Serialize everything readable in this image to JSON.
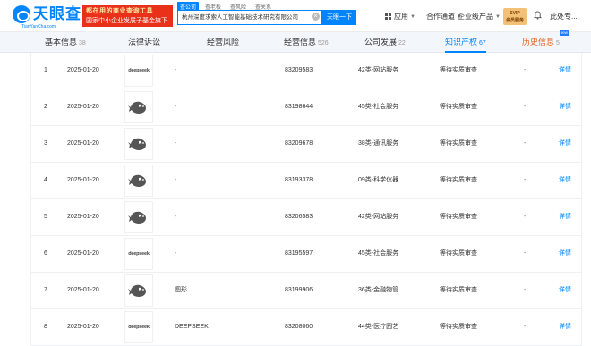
{
  "header": {
    "logo_text": "天眼查",
    "logo_sub": "TianYanCha.com",
    "promo_line1": "都在用的商业查询工具",
    "promo_line2": "国家中小企业发展子基金旗下机构",
    "search_tabs": [
      "查公司",
      "查老板",
      "查风险",
      "查关系"
    ],
    "search_value": "杭州深度求索人工智能基础技术研究有限公司",
    "search_button": "天眼一下",
    "nav": [
      {
        "label": "应用",
        "icon": "grid-icon"
      },
      {
        "label": "合作通道"
      },
      {
        "label": "企业级产品"
      }
    ],
    "vip_line1": "SVIP",
    "vip_line2": "会员服务",
    "user_name": "此处专..."
  },
  "tabs": [
    {
      "label": "基本信息",
      "count": "38"
    },
    {
      "label": "法律诉讼",
      "count": ""
    },
    {
      "label": "经营风险",
      "count": ""
    },
    {
      "label": "经营信息",
      "count": "526"
    },
    {
      "label": "公司发展",
      "count": "22"
    },
    {
      "label": "知识产权",
      "count": "67"
    },
    {
      "label": "历史信息",
      "count": "5",
      "badge": "new"
    }
  ],
  "rows": [
    {
      "idx": "1",
      "date": "2025-01-20",
      "logo": "deepseek-wordmark",
      "logo_text": "deepseek",
      "name": "-",
      "regno": "83209583",
      "class": "42类-网站服务",
      "status": "等待实质审查",
      "dash": "-",
      "detail": "详情"
    },
    {
      "idx": "2",
      "date": "2025-01-20",
      "logo": "whale-icon",
      "logo_text": "",
      "name": "-",
      "regno": "83198644",
      "class": "45类-社会服务",
      "status": "等待实质审查",
      "dash": "-",
      "detail": "详情"
    },
    {
      "idx": "3",
      "date": "2025-01-20",
      "logo": "whale-icon",
      "logo_text": "",
      "name": "-",
      "regno": "83209678",
      "class": "38类-通讯服务",
      "status": "等待实质审查",
      "dash": "-",
      "detail": "详情"
    },
    {
      "idx": "4",
      "date": "2025-01-20",
      "logo": "whale-icon",
      "logo_text": "",
      "name": "-",
      "regno": "83193378",
      "class": "09类-科学仪器",
      "status": "等待实质审查",
      "dash": "-",
      "detail": "详情"
    },
    {
      "idx": "5",
      "date": "2025-01-20",
      "logo": "whale-icon",
      "logo_text": "",
      "name": "-",
      "regno": "83206583",
      "class": "42类-网站服务",
      "status": "等待实质审查",
      "dash": "-",
      "detail": "详情"
    },
    {
      "idx": "6",
      "date": "2025-01-20",
      "logo": "deepseek-wordmark",
      "logo_text": "deepseek",
      "name": "-",
      "regno": "83195597",
      "class": "45类-社会服务",
      "status": "等待实质审查",
      "dash": "-",
      "detail": "详情"
    },
    {
      "idx": "7",
      "date": "2025-01-20",
      "logo": "whale-icon",
      "logo_text": "",
      "name": "图形",
      "regno": "83199906",
      "class": "36类-金融物管",
      "status": "等待实质审查",
      "dash": "-",
      "detail": "详情"
    },
    {
      "idx": "8",
      "date": "2025-01-20",
      "logo": "deepseek-wordmark",
      "logo_text": "deepseek",
      "name": "DEEPSEEK",
      "regno": "83208060",
      "class": "44类-医疗园艺",
      "status": "等待实质审查",
      "dash": "-",
      "detail": "详情"
    }
  ],
  "colors": {
    "accent": "#0084ff",
    "promo": "#e9311a",
    "hot_tab": "#e65d1a"
  }
}
